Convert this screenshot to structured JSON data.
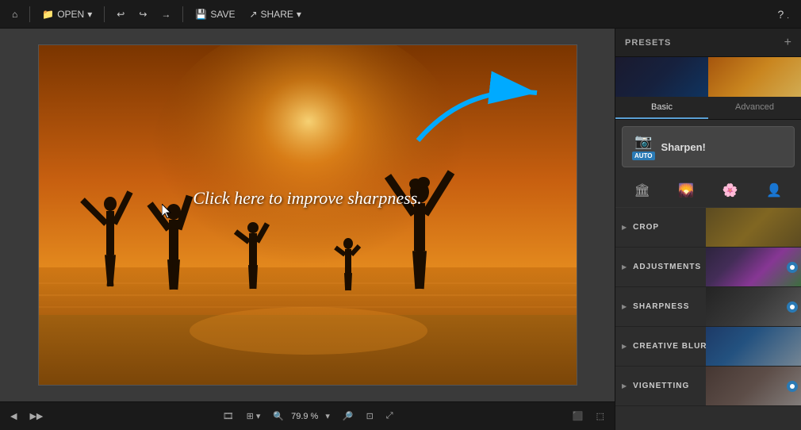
{
  "toolbar": {
    "home_label": "⌂",
    "open_label": "OPEN",
    "open_arrow": "▾",
    "undo_label": "↩",
    "redo_back": "↪",
    "redo_fwd": "→",
    "save_label": "SAVE",
    "share_label": "SHARE",
    "share_arrow": "▾",
    "help_label": "?"
  },
  "canvas": {
    "click_text": "Click here to improve sharpness.",
    "cursor_symbol": "▸"
  },
  "bottom_bar": {
    "zoom_value": "79.9 %",
    "zoom_arrow": "▾"
  },
  "right_panel": {
    "presets_label": "PRESETS",
    "add_label": "+",
    "tabs": [
      {
        "label": "Basic",
        "active": true
      },
      {
        "label": "Advanced",
        "active": false
      }
    ],
    "sharpen_btn": {
      "icon": "📷",
      "auto_label": "AUTO",
      "label": "Sharpen!"
    },
    "icons": [
      {
        "symbol": "🏛",
        "name": "building-icon"
      },
      {
        "symbol": "🌄",
        "name": "landscape-icon"
      },
      {
        "symbol": "🌸",
        "name": "flower-icon"
      },
      {
        "symbol": "👤",
        "name": "person-icon"
      }
    ],
    "sections": [
      {
        "label": "CROP",
        "has_badge": false
      },
      {
        "label": "ADJUSTMENTS",
        "has_badge": true
      },
      {
        "label": "SHARPNESS",
        "has_badge": true
      },
      {
        "label": "CREATIVE BLUR",
        "has_badge": false
      },
      {
        "label": "VIGNETTING",
        "has_badge": true
      }
    ]
  }
}
